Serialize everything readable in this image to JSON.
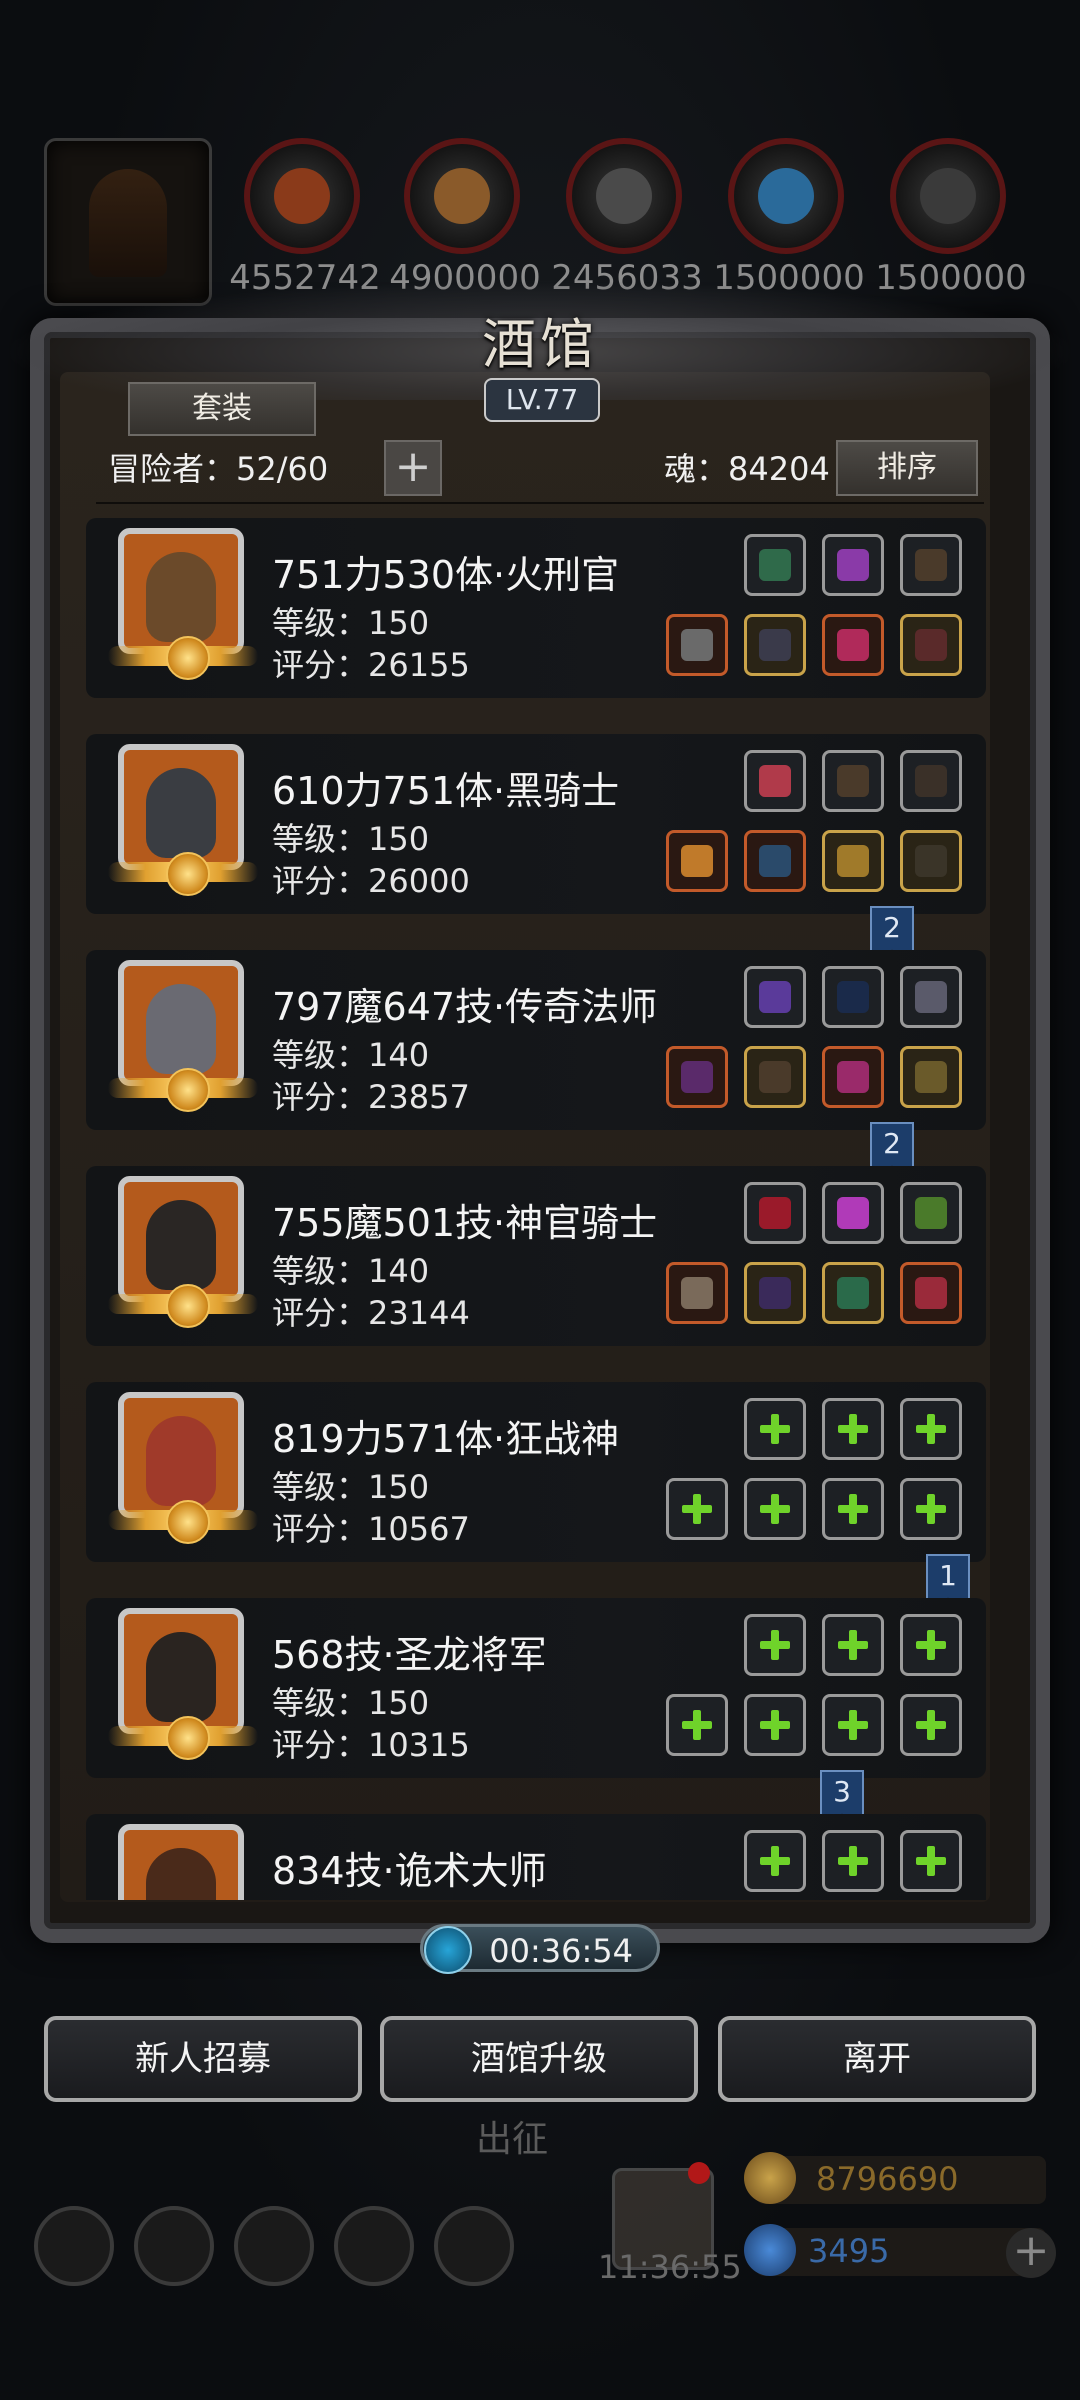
{
  "resources": [
    "4552742",
    "4900000",
    "2456033",
    "1500000",
    "1500000"
  ],
  "panel": {
    "title": "酒馆",
    "level": "LV.77",
    "set_button": "套装",
    "adventurer_count": "冒险者：52/60",
    "soul": "魂：84204",
    "sort_button": "排序"
  },
  "heroes": [
    {
      "name": "751力530体·火刑官",
      "level": "等级：150",
      "score": "评分：26155"
    },
    {
      "name": "610力751体·黑骑士",
      "level": "等级：150",
      "score": "评分：26000"
    },
    {
      "name": "797魔647技·传奇法师",
      "level": "等级：140",
      "score": "评分：23857"
    },
    {
      "name": "755魔501技·神官骑士",
      "level": "等级：140",
      "score": "评分：23144"
    },
    {
      "name": "819力571体·狂战神",
      "level": "等级：150",
      "score": "评分：10567"
    },
    {
      "name": "568技·圣龙将军",
      "level": "等级：150",
      "score": "评分：10315"
    },
    {
      "name": "834技·诡术大师",
      "level": "",
      "score": ""
    }
  ],
  "bookmarks": [
    "2",
    "2",
    "1",
    "3"
  ],
  "timer": "00:36:54",
  "actions": {
    "recruit": "新人招募",
    "upgrade": "酒馆升级",
    "leave": "离开"
  },
  "background": {
    "expedition": "出征",
    "clock": "11:36:55",
    "gold": "8796690",
    "gems": "3495"
  },
  "colors": {
    "accent_green": "#6fd32a",
    "panel_bg": "#2a241d",
    "bookmark_blue": "#1c3d6a"
  }
}
